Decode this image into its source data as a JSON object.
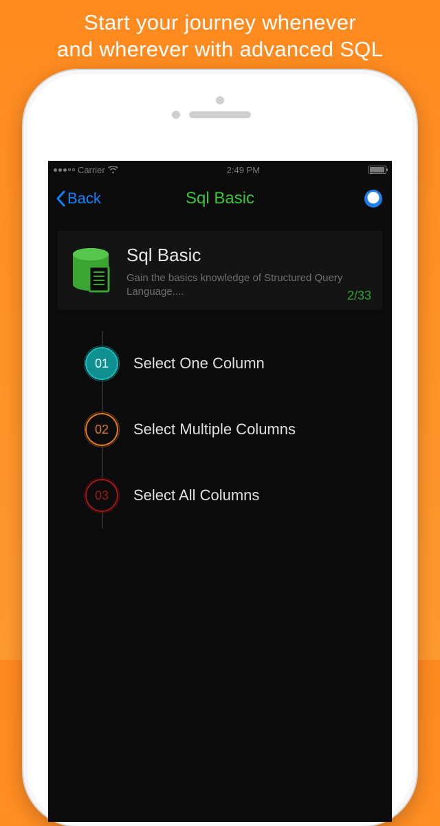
{
  "promo": {
    "line1": "Start your journey whenever",
    "line2": "and wherever with advanced SQL"
  },
  "status": {
    "carrier": "Carrier",
    "time": "2:49 PM"
  },
  "nav": {
    "back_label": "Back",
    "title": "Sql Basic"
  },
  "card": {
    "title": "Sql Basic",
    "description": "Gain the basics knowledge of Structured Query Language....",
    "progress": "2/33"
  },
  "lessons": [
    {
      "num": "01",
      "title": "Select One Column"
    },
    {
      "num": "02",
      "title": "Select Multiple Columns"
    },
    {
      "num": "03",
      "title": "Select All Columns"
    }
  ]
}
